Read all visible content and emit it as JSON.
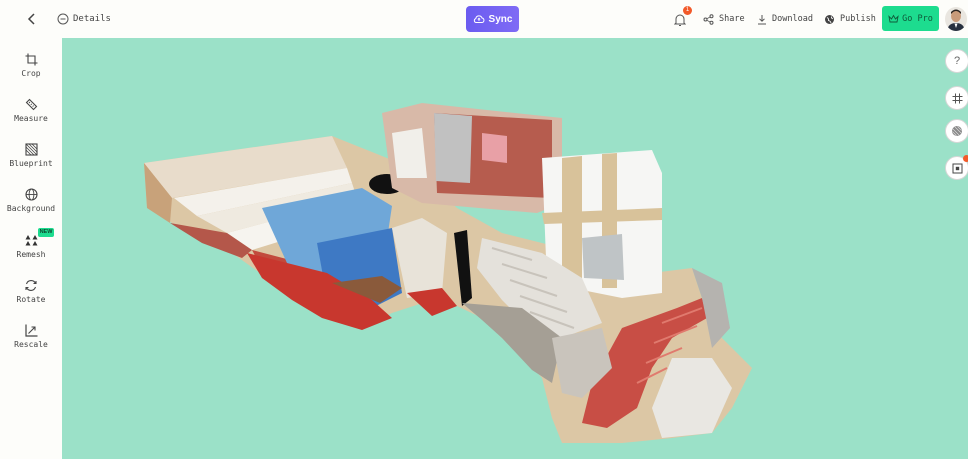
{
  "topbar": {
    "details_label": "Details",
    "sync_label": "Sync",
    "notification_count": "1",
    "share_label": "Share",
    "download_label": "Download",
    "publish_label": "Publish",
    "gopro_label": "Go Pro"
  },
  "sidebar": {
    "tools": [
      {
        "label": "Crop",
        "icon": "crop-icon"
      },
      {
        "label": "Measure",
        "icon": "ruler-icon"
      },
      {
        "label": "Blueprint",
        "icon": "blueprint-icon"
      },
      {
        "label": "Background",
        "icon": "globe-icon"
      },
      {
        "label": "Remesh",
        "icon": "remesh-icon",
        "badge": "NEW"
      },
      {
        "label": "Rotate",
        "icon": "rotate-icon"
      },
      {
        "label": "Rescale",
        "icon": "rescale-icon"
      }
    ]
  },
  "viewport": {
    "background_color": "#9be1c8"
  },
  "right_tools": {
    "help_label": "?"
  },
  "colors": {
    "accent_sync": "#6b5cf0",
    "accent_gopro": "#1ddc8f",
    "badge": "#f25a2a"
  }
}
